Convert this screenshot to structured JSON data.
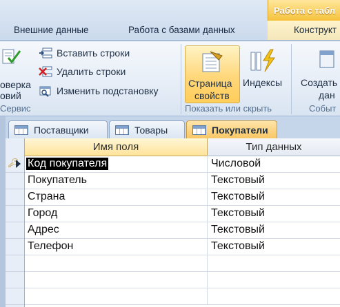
{
  "ribbon": {
    "context_tab_title": "Работа с табл",
    "tabs": [
      "Внешние данные",
      "Работа с базами данных",
      "Конструкт"
    ],
    "service": {
      "check_line1": "оверка",
      "check_line2": "овий",
      "insert_rows": "Вставить строки",
      "delete_rows": "Удалить строки",
      "change_lookup": "Изменить подстановку",
      "group_label": "Сервис"
    },
    "show_hide": {
      "property_sheet_line1": "Страница",
      "property_sheet_line2": "свойств",
      "indexes": "Индексы",
      "group_label": "Показать или скрыть"
    },
    "events": {
      "create_line1": "Создать",
      "create_line2": "дан",
      "group_label": "Событ"
    }
  },
  "document_tabs": [
    {
      "label": "Поставщики",
      "active": false
    },
    {
      "label": "Товары",
      "active": false
    },
    {
      "label": "Покупатели",
      "active": true
    }
  ],
  "grid": {
    "headers": {
      "field_name": "Имя поля",
      "data_type": "Тип данных"
    },
    "rows": [
      {
        "field": "Код покупателя",
        "type": "Числовой"
      },
      {
        "field": "Покупатель",
        "type": "Текстовый"
      },
      {
        "field": "Страна",
        "type": "Текстовый"
      },
      {
        "field": "Город",
        "type": "Текстовый"
      },
      {
        "field": "Адрес",
        "type": "Текстовый"
      },
      {
        "field": "Телефон",
        "type": "Текстовый"
      }
    ]
  },
  "colors": {
    "accent": "#ffd77a",
    "selection": "#000000"
  }
}
